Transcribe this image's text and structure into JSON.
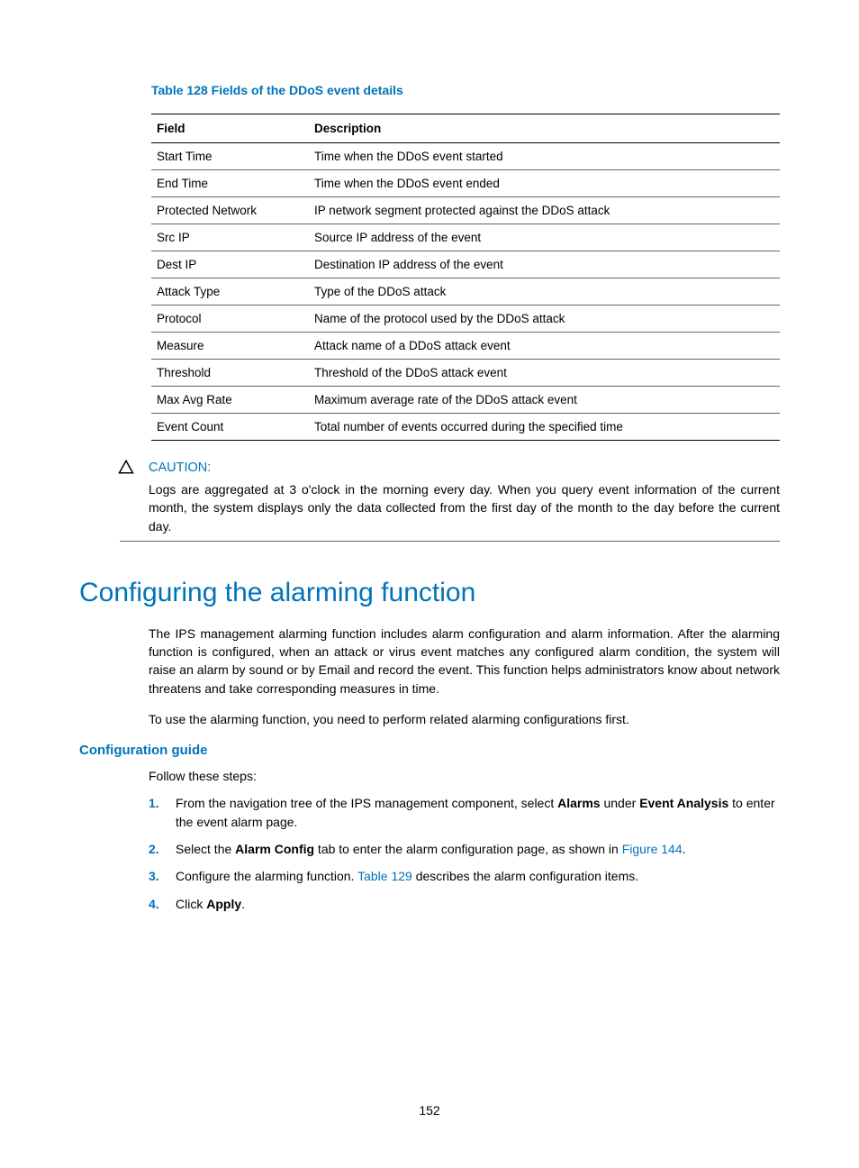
{
  "table": {
    "title": "Table 128 Fields of the DDoS event details",
    "headers": {
      "col1": "Field",
      "col2": "Description"
    },
    "rows": [
      {
        "field": "Start Time",
        "desc": "Time when the DDoS event started"
      },
      {
        "field": "End Time",
        "desc": "Time when the DDoS event ended"
      },
      {
        "field": "Protected Network",
        "desc": "IP network segment protected against the DDoS attack"
      },
      {
        "field": "Src IP",
        "desc": "Source IP address of the event"
      },
      {
        "field": "Dest IP",
        "desc": "Destination IP address of the event"
      },
      {
        "field": "Attack Type",
        "desc": "Type of the DDoS attack"
      },
      {
        "field": "Protocol",
        "desc": "Name of the protocol used by the DDoS attack"
      },
      {
        "field": "Measure",
        "desc": "Attack name of a DDoS attack event"
      },
      {
        "field": "Threshold",
        "desc": "Threshold of the DDoS attack event"
      },
      {
        "field": "Max Avg Rate",
        "desc": "Maximum average rate of the DDoS attack event"
      },
      {
        "field": "Event Count",
        "desc": "Total number of events occurred during the specified time"
      }
    ]
  },
  "caution": {
    "label": "CAUTION:",
    "text": "Logs are aggregated at 3 o'clock in the morning every day. When you query event information of the current month, the system displays only the data collected from the first day of the month to the day before the current day."
  },
  "sectionHeading": "Configuring the alarming function",
  "para1": "The IPS management alarming function includes alarm configuration and alarm information. After the alarming function is configured, when an attack or virus event matches any configured alarm condition, the system will raise an alarm by sound or by Email and record the event. This function helps administrators know about network threatens and take corresponding measures in time.",
  "para2": "To use the alarming function, you need to perform related alarming configurations first.",
  "subsectionHeading": "Configuration guide",
  "followText": "Follow these steps:",
  "steps": {
    "s1_a": "From the navigation tree of the IPS management component, select ",
    "s1_b": "Alarms",
    "s1_c": " under ",
    "s1_d": "Event Analysis",
    "s1_e": " to enter the event alarm page.",
    "s2_a": "Select the ",
    "s2_b": "Alarm Config",
    "s2_c": " tab to enter the alarm configuration page, as shown in ",
    "s2_link": "Figure 144",
    "s2_d": ".",
    "s3_a": "Configure the alarming function. ",
    "s3_link": "Table 129",
    "s3_b": " describes the alarm configuration items.",
    "s4_a": "Click ",
    "s4_b": "Apply",
    "s4_c": "."
  },
  "pageNumber": "152"
}
